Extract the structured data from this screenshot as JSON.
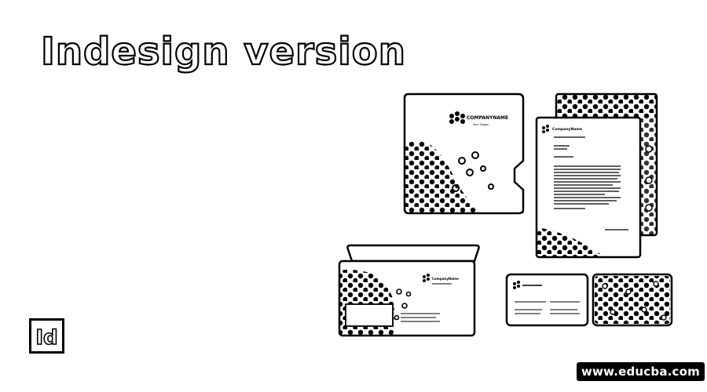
{
  "header": {
    "title": "Indesign version"
  },
  "illustration": {
    "folder": {
      "company_name": "COMPANYNAME",
      "tagline": "Your Slogan"
    },
    "letterhead": {
      "company_name": "CompanyName"
    },
    "envelope": {
      "company_name": "CompanyName"
    }
  },
  "logo": {
    "text": "Id",
    "icon": "indesign-icon"
  },
  "footer": {
    "site": "www.educba.com"
  }
}
